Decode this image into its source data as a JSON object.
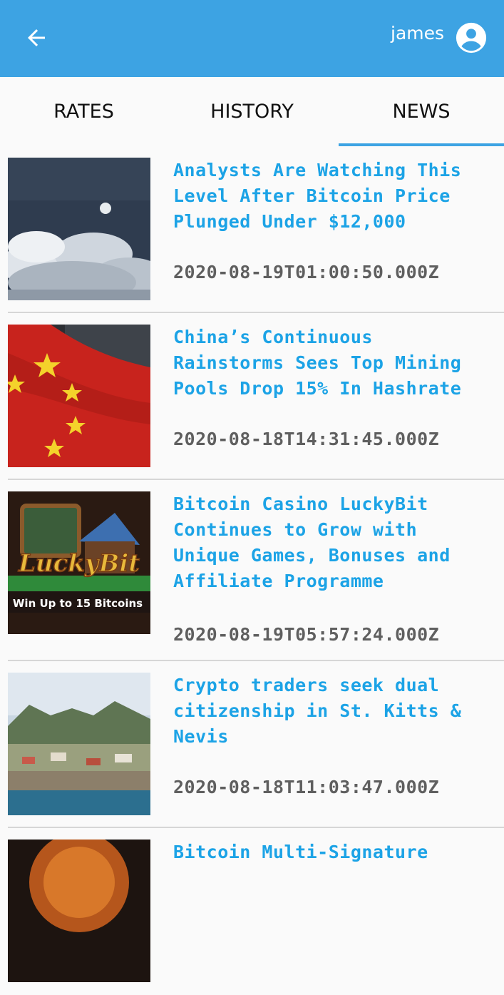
{
  "appbar": {
    "back_icon": "arrow-left-icon",
    "username": "james",
    "account_icon": "account-circle-icon",
    "color": "#3da3e3"
  },
  "tabs": [
    {
      "label": "RATES",
      "selected": false
    },
    {
      "label": "HISTORY",
      "selected": false
    },
    {
      "label": "NEWS",
      "selected": true
    }
  ],
  "news": [
    {
      "title": "Analysts Are Watching This Level After Bitcoin Price Plunged Under $12,000",
      "date": "2020-08-19T01:00:50.000Z",
      "image": "clouds-moon-image"
    },
    {
      "title": "China’s Continuous Rainstorms Sees Top Mining Pools Drop 15% In Hashrate",
      "date": "2020-08-18T14:31:45.000Z",
      "image": "china-flag-image"
    },
    {
      "title": "Bitcoin Casino LuckyBit Continues to Grow with Unique Games, Bonuses and Affiliate Programme",
      "date": "2020-08-19T05:57:24.000Z",
      "image": "luckybit-casino-image",
      "image_text": [
        "LuckyBit",
        "Win Up to 15 Bitcoins"
      ]
    },
    {
      "title": "Crypto traders seek dual citizenship in St. Kitts & Nevis",
      "date": "2020-08-18T11:03:47.000Z",
      "image": "island-coast-image"
    },
    {
      "title": "Bitcoin Multi-Signature",
      "date": "",
      "image": "orange-coin-image"
    }
  ],
  "colors": {
    "title": "#1ca3e6",
    "date": "#5f5f5f",
    "divider": "#d6d6d6"
  }
}
